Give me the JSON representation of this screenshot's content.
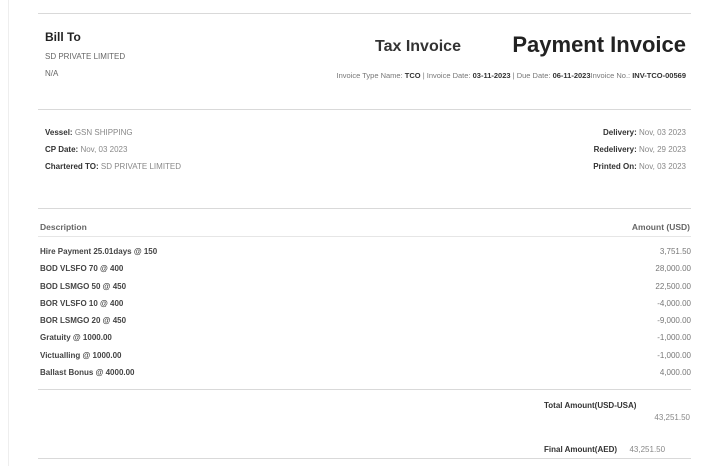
{
  "bill_to": {
    "title": "Bill To",
    "company": "SD PRIVATE LIMITED",
    "address": "N/A"
  },
  "header": {
    "tax_invoice": "Tax Invoice",
    "payment_invoice": "Payment Invoice",
    "invoice_type_label": "Invoice Type Name:",
    "invoice_type_value": "TCO",
    "invoice_date_label": "| Invoice Date:",
    "invoice_date_value": "03-11-2023",
    "due_date_label": "| Due Date:",
    "due_date_value": "06-11-2023",
    "invoice_no_label": "Invoice No.:",
    "invoice_no_value": "INV-TCO-00569"
  },
  "vessel_info": {
    "vessel_label": "Vessel:",
    "vessel_value": "GSN SHIPPING",
    "cp_date_label": "CP Date:",
    "cp_date_value": "Nov, 03 2023",
    "chartered_label": "Chartered TO:",
    "chartered_value": "SD PRIVATE LIMITED",
    "delivery_label": "Delivery:",
    "delivery_value": "Nov, 03 2023",
    "redelivery_label": "Redelivery:",
    "redelivery_value": "Nov, 29 2023",
    "printed_label": "Printed On:",
    "printed_value": "Nov, 03 2023"
  },
  "table": {
    "col_description": "Description",
    "col_amount": "Amount (USD)",
    "rows": [
      {
        "description": "Hire Payment 25.01days @ 150",
        "amount": "3,751.50"
      },
      {
        "description": "BOD VLSFO 70 @ 400",
        "amount": "28,000.00"
      },
      {
        "description": "BOD LSMGO 50 @ 450",
        "amount": "22,500.00"
      },
      {
        "description": "BOR VLSFO 10 @ 400",
        "amount": "-4,000.00"
      },
      {
        "description": "BOR LSMGO 20 @ 450",
        "amount": "-9,000.00"
      },
      {
        "description": "Gratuity @ 1000.00",
        "amount": "-1,000.00"
      },
      {
        "description": "Victualling @ 1000.00",
        "amount": "-1,000.00"
      },
      {
        "description": "Ballast Bonus @ 4000.00",
        "amount": "4,000.00"
      }
    ]
  },
  "totals": {
    "total_label": "Total Amount(USD-USA)",
    "total_value": "43,251.50",
    "final_label": "Final Amount(AED)",
    "final_value": "43,251.50"
  }
}
